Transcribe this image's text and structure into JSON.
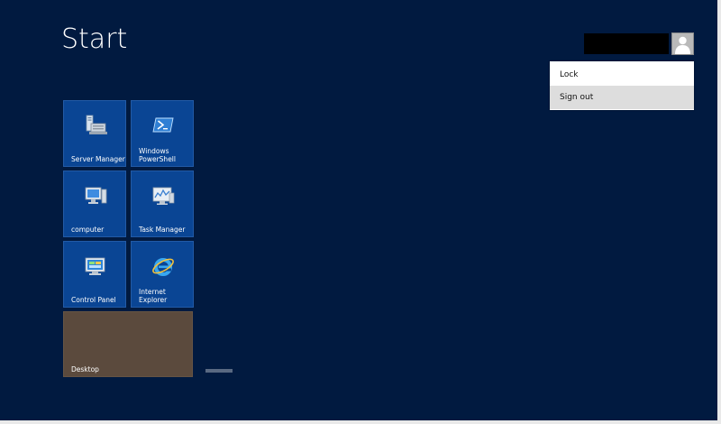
{
  "start": {
    "title": "Start"
  },
  "user_menu": {
    "items": [
      {
        "label": "Lock"
      },
      {
        "label": "Sign out"
      }
    ]
  },
  "tiles": [
    {
      "label": "Server Manager",
      "icon": "server-manager-icon"
    },
    {
      "label": "Windows\nPowerShell",
      "icon": "powershell-icon"
    },
    {
      "label": "computer",
      "icon": "computer-icon"
    },
    {
      "label": "Task Manager",
      "icon": "task-manager-icon"
    },
    {
      "label": "Control Panel",
      "icon": "control-panel-icon"
    },
    {
      "label": "Internet Explorer",
      "icon": "internet-explorer-icon"
    },
    {
      "label": "Desktop",
      "icon": "desktop-icon"
    }
  ],
  "colors": {
    "background": "#011a40",
    "tile": "#0a4594",
    "desktop_tile": "#5b4a3d"
  }
}
